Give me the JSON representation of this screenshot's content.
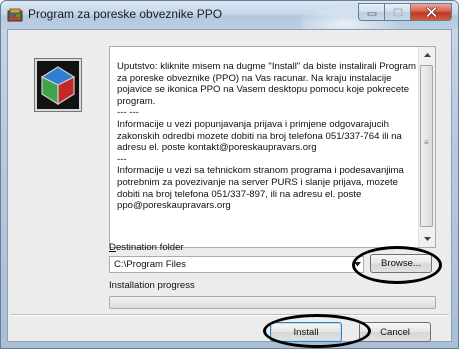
{
  "window": {
    "title": "Program za poreske obveznike PPO"
  },
  "info_text": [
    "Uputstvo: kliknite misem na dugme \"Install\" da biste instalirali Program za poreske obveznike (PPO) na Vas racunar. Na kraju instalacije pojavice se ikonica PPO na Vasem desktopu pomocu koje pokrecete program.",
    "--- ---",
    "Informacije u vezi popunjavanja prijava i primjene odgovarajucih zakonskih odredbi mozete dobiti na broj telefona 051/337-764 ili na adresu el. poste kontakt@poreskaupravars.org",
    "---",
    "Informacije u vezi sa tehnickom stranom programa i podesavanjima potrebnim za povezivanje na server PURS i slanje prijava, mozete dobiti na broj telefona 051/337-897, ili na adresu el. poste ppo@poreskaupravars.org"
  ],
  "destination": {
    "label_accel": "D",
    "label_rest": "estination folder",
    "value": "C:\\Program Files",
    "browse_label": "Browse..."
  },
  "progress": {
    "label": "Installation progress",
    "value_percent": 0
  },
  "buttons": {
    "install_label": "Install",
    "cancel_label": "Cancel"
  },
  "colors": {
    "progress_fill": "#3cb43c",
    "close_button": "#c0381f",
    "default_button_border": "#3c7fb1"
  }
}
